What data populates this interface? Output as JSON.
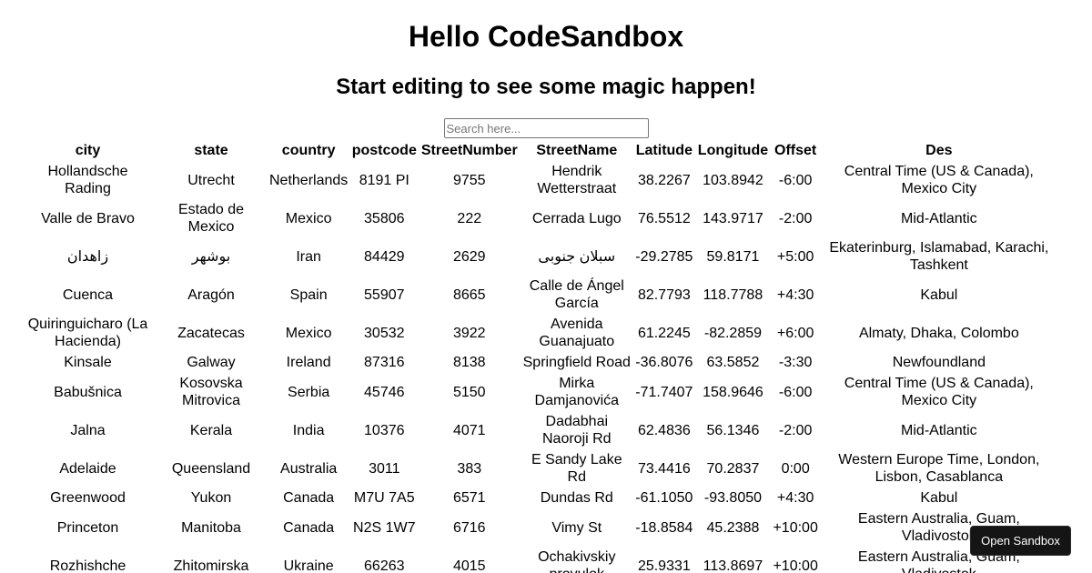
{
  "header": {
    "title": "Hello CodeSandbox",
    "subtitle": "Start editing to see some magic happen!"
  },
  "search": {
    "placeholder": "Search here...",
    "value": ""
  },
  "table": {
    "columns": [
      "city",
      "state",
      "country",
      "postcode",
      "StreetNumber",
      "StreetName",
      "Latitude",
      "Longitude",
      "Offset",
      "Des"
    ],
    "rows": [
      [
        "Hollandsche Rading",
        "Utrecht",
        "Netherlands",
        "8191 PI",
        "9755",
        "Hendrik Wetterstraat",
        "38.2267",
        "103.8942",
        "-6:00",
        "Central Time (US & Canada), Mexico City"
      ],
      [
        "Valle de Bravo",
        "Estado de Mexico",
        "Mexico",
        "35806",
        "222",
        "Cerrada Lugo",
        "76.5512",
        "143.9717",
        "-2:00",
        "Mid-Atlantic"
      ],
      [
        "زاهدان",
        "بوشهر",
        "Iran",
        "84429",
        "2629",
        "سبلان جنوبی",
        "-29.2785",
        "59.8171",
        "+5:00",
        "Ekaterinburg, Islamabad, Karachi, Tashkent"
      ],
      [
        "Cuenca",
        "Aragón",
        "Spain",
        "55907",
        "8665",
        "Calle de Ángel García",
        "82.7793",
        "118.7788",
        "+4:30",
        "Kabul"
      ],
      [
        "Quiringuicharo (La Hacienda)",
        "Zacatecas",
        "Mexico",
        "30532",
        "3922",
        "Avenida Guanajuato",
        "61.2245",
        "-82.2859",
        "+6:00",
        "Almaty, Dhaka, Colombo"
      ],
      [
        "Kinsale",
        "Galway",
        "Ireland",
        "87316",
        "8138",
        "Springfield Road",
        "-36.8076",
        "63.5852",
        "-3:30",
        "Newfoundland"
      ],
      [
        "Babušnica",
        "Kosovska Mitrovica",
        "Serbia",
        "45746",
        "5150",
        "Mirka Damjanovića",
        "-71.7407",
        "158.9646",
        "-6:00",
        "Central Time (US & Canada), Mexico City"
      ],
      [
        "Jalna",
        "Kerala",
        "India",
        "10376",
        "4071",
        "Dadabhai Naoroji Rd",
        "62.4836",
        "56.1346",
        "-2:00",
        "Mid-Atlantic"
      ],
      [
        "Adelaide",
        "Queensland",
        "Australia",
        "3011",
        "383",
        "E Sandy Lake Rd",
        "73.4416",
        "70.2837",
        "0:00",
        "Western Europe Time, London, Lisbon, Casablanca"
      ],
      [
        "Greenwood",
        "Yukon",
        "Canada",
        "M7U 7A5",
        "6571",
        "Dundas Rd",
        "-61.1050",
        "-93.8050",
        "+4:30",
        "Kabul"
      ],
      [
        "Princeton",
        "Manitoba",
        "Canada",
        "N2S 1W7",
        "6716",
        "Vimy St",
        "-18.8584",
        "45.2388",
        "+10:00",
        "Eastern Australia, Guam, Vladivostok"
      ],
      [
        "Rozhishche",
        "Zhitomirska",
        "Ukraine",
        "66263",
        "4015",
        "Ochakivskiy provulok",
        "25.9331",
        "113.8697",
        "+10:00",
        "Eastern Australia, Guam, Vladivostok"
      ]
    ]
  },
  "sandbox_button": {
    "label": "Open Sandbox"
  }
}
